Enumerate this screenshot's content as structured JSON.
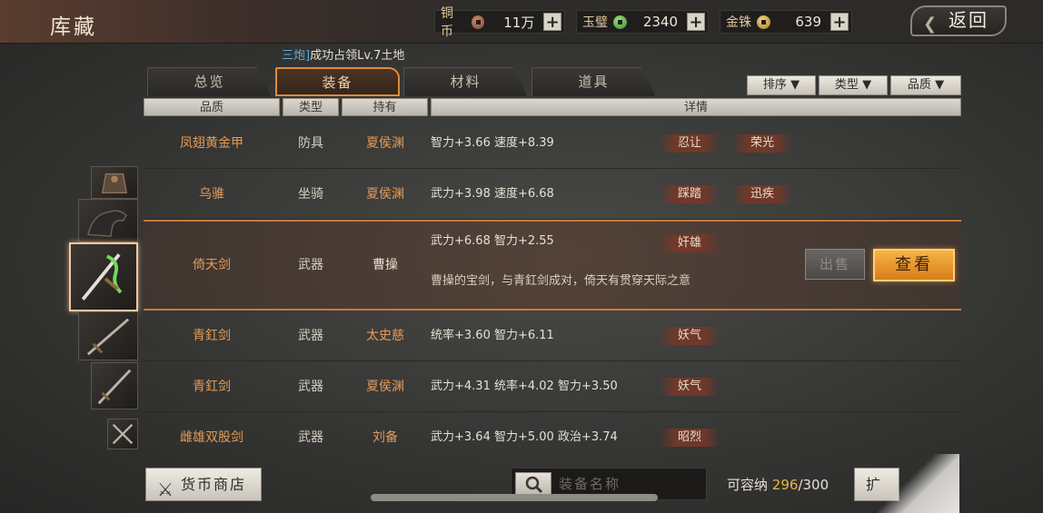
{
  "header": {
    "title": "库藏",
    "back_label": "返回"
  },
  "currencies": [
    {
      "name": "铜币",
      "value": "11万",
      "icon": "copper-coin-icon"
    },
    {
      "name": "玉璧",
      "value": "2340",
      "icon": "jade-disc-icon"
    },
    {
      "name": "金铢",
      "value": "639",
      "icon": "gold-coin-icon"
    }
  ],
  "notice": {
    "highlight": "三炮]",
    "text": "成功占领Lv.7土地"
  },
  "tabs": [
    "总览",
    "装备",
    "材料",
    "道具"
  ],
  "active_tab": "装备",
  "filters": [
    "排序",
    "类型",
    "品质"
  ],
  "columns": [
    "品质",
    "类型",
    "持有",
    "详情"
  ],
  "items": [
    {
      "name": "凤翅黄金甲",
      "type": "防具",
      "owner": "夏侯渊",
      "stats": "智力+3.66  速度+8.39",
      "tags": [
        "忍让",
        "荣光"
      ]
    },
    {
      "name": "乌骓",
      "type": "坐骑",
      "owner": "夏侯渊",
      "stats": "武力+3.98  速度+6.68",
      "tags": [
        "踩踏",
        "迅疾"
      ]
    },
    {
      "name": "倚天剑",
      "type": "武器",
      "owner": "曹操",
      "stats": "武力+6.68  智力+2.55",
      "tags": [
        "奸雄"
      ],
      "desc": "曹操的宝剑，与青釭剑成对，倚天有贯穿天际之意",
      "selected": true
    },
    {
      "name": "青釭剑",
      "type": "武器",
      "owner": "太史慈",
      "stats": "统率+3.60  智力+6.11",
      "tags": [
        "妖气"
      ]
    },
    {
      "name": "青釭剑",
      "type": "武器",
      "owner": "夏侯渊",
      "stats": "武力+4.31  统率+4.02  智力+3.50",
      "tags": [
        "妖气"
      ]
    },
    {
      "name": "雌雄双股剑",
      "type": "武器",
      "owner": "刘备",
      "stats": "武力+3.64  智力+5.00  政治+3.74",
      "tags": [
        "昭烈"
      ]
    }
  ],
  "actions": {
    "sell": "出售",
    "view": "查看"
  },
  "footer": {
    "shop_label": "货币商店",
    "search_placeholder": "装备名称",
    "capacity_label": "可容纳",
    "capacity_current": "296",
    "capacity_total": "/300",
    "partial_button": "扩"
  },
  "colors": {
    "accent": "#e08a3c",
    "quality_orange": "#e49b57",
    "view_button": "#f0a43a"
  }
}
